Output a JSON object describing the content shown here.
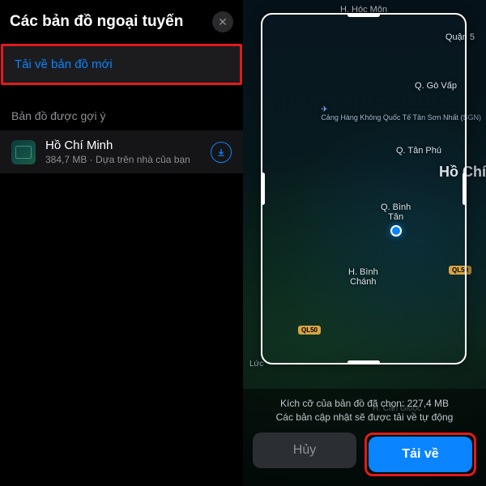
{
  "left": {
    "title": "Các bản đồ ngoại tuyến",
    "close_icon_label": "✕",
    "new_map_row": "Tải về bản đồ mới",
    "suggested_header": "Bản đồ được gợi ý",
    "suggestion": {
      "name": "Hồ Chí Minh",
      "subtitle": "384,7 MB · Dựa trên nhà của bạn"
    }
  },
  "right": {
    "labels": {
      "hocmon": "H. Hóc Môn",
      "quan5": "Quận 5",
      "govap": "Q. Gò Vấp",
      "airport": "Cảng Hàng Không\nQuốc Tế Tân Sơn\nNhất (SGN)",
      "tanphu": "Q. Tân Phú",
      "city": "Hồ Chí",
      "binhtan": "Q. Bình\nTân",
      "binhchanh": "H. Bình\nChánh",
      "luc": "Lức",
      "cangiuoc": "H. Cần Giuộc",
      "road": "QL50"
    },
    "footer_line1": "Kích cỡ của bản đồ đã chọn: 227,4 MB",
    "footer_line2": "Các bản cập nhật sẽ được tải về tự động",
    "cancel": "Hủy",
    "download": "Tải về"
  }
}
